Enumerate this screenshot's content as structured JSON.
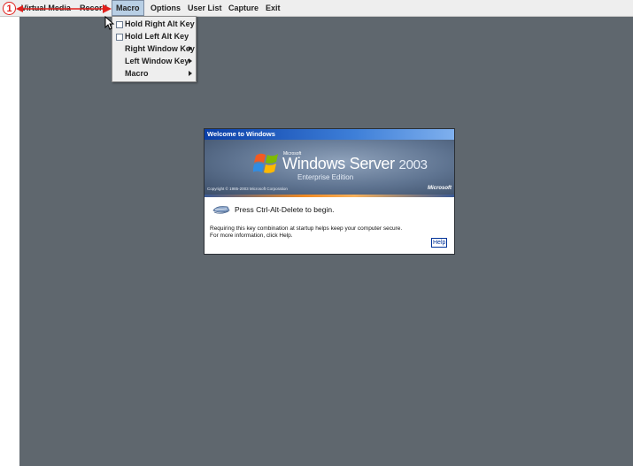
{
  "callout": {
    "number": "1"
  },
  "menubar": {
    "items": [
      {
        "label": "Virtual Media"
      },
      {
        "label": "Record"
      },
      {
        "label": "Macro"
      },
      {
        "label": "Options"
      },
      {
        "label": "User List"
      },
      {
        "label": "Capture"
      },
      {
        "label": "Exit"
      }
    ]
  },
  "dropdown": {
    "items": [
      {
        "label": "Hold Right Alt Key",
        "checkbox": true
      },
      {
        "label": "Hold Left Alt Key",
        "checkbox": true
      },
      {
        "label": "Right Window Key",
        "submenu": true
      },
      {
        "label": "Left Window Key",
        "submenu": true
      },
      {
        "label": "Macro",
        "submenu": true
      }
    ]
  },
  "dialog": {
    "title": "Welcome to Windows",
    "microsoft_small": "Microsoft",
    "product": "Windows Server",
    "year": "2003",
    "edition": "Enterprise Edition",
    "copyright": "Copyright © 1985-2003  Microsoft Corporation",
    "brand": "Microsoft",
    "press_text": "Press Ctrl-Alt-Delete to begin.",
    "requiring_text": "Requiring this key combination at startup helps keep your computer secure. For more information, click Help.",
    "help_label": "Help"
  },
  "colors": {
    "desktop": "#5f676e",
    "callout_red": "#e0201c",
    "menu_active": "#b8cfe5"
  }
}
